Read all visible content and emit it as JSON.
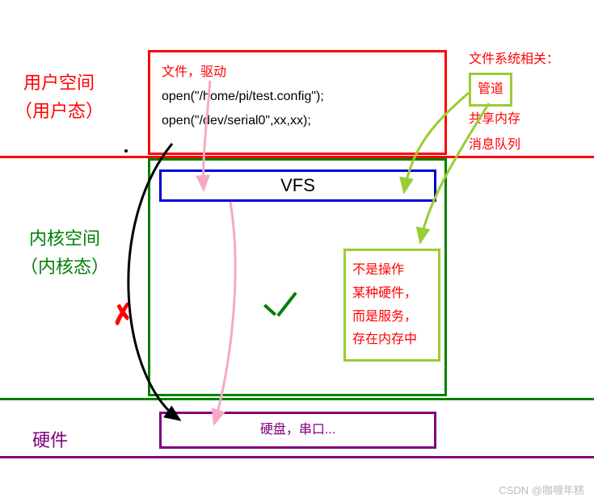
{
  "left_labels": {
    "user_space_line1": "用户空间",
    "user_space_line2": "（用户态）",
    "kernel_space_line1": "内核空间",
    "kernel_space_line2": "（内核态）",
    "hardware": "硬件"
  },
  "red_box": {
    "header": "文件，驱动",
    "code1": "open(\"/home/pi/test.config\");",
    "code2": "open(\"/dev/serial0\",xx,xx);"
  },
  "vfs_label": "VFS",
  "yellow_box": {
    "line1": "不是操作",
    "line2": "某种硬件，",
    "line3": "而是服务，",
    "line4": "存在内存中"
  },
  "purple_box": "硬盘，串口...",
  "side_list": {
    "title": "文件系统相关：",
    "item1": "管道",
    "item2": "共享内存",
    "item3": "消息队列"
  },
  "marks": {
    "cross": "✗",
    "check": "✓"
  },
  "watermark": "CSDN @咖喱年糕"
}
